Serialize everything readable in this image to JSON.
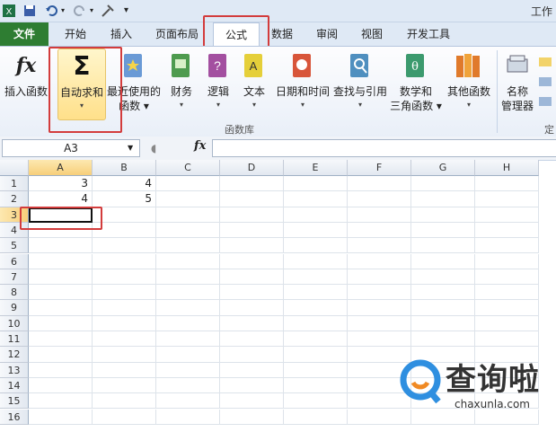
{
  "app": {
    "title": "工作"
  },
  "tabs": [
    "文件",
    "开始",
    "插入",
    "页面布局",
    "公式",
    "数据",
    "审阅",
    "视图",
    "开发工具"
  ],
  "ribbon": {
    "insert_function": "插入函数",
    "autosum_line1": "自动求和",
    "recent_line1": "最近使用的",
    "recent_line2": "函数",
    "financial": "财务",
    "logical": "逻辑",
    "text": "文本",
    "datetime": "日期和时间",
    "lookup": "查找与引用",
    "math_line1": "数学和",
    "math_line2": "三角函数",
    "other": "其他函数",
    "name_mgr_line1": "名称",
    "name_mgr_line2": "管理器",
    "edge_label": "定",
    "group_label": "函数库",
    "sigma": "Σ",
    "fx": "fx"
  },
  "formula_bar": {
    "name_box": "A3",
    "fx": "fx"
  },
  "columns": [
    "A",
    "B",
    "C",
    "D",
    "E",
    "F",
    "G",
    "H"
  ],
  "rows": [
    "1",
    "2",
    "3",
    "4",
    "5",
    "6",
    "7",
    "8",
    "9",
    "10",
    "11",
    "12",
    "13",
    "14",
    "15",
    "16"
  ],
  "cells": {
    "A1": "3",
    "B1": "4",
    "A2": "4",
    "B2": "5"
  },
  "watermark": {
    "text": "查询啦",
    "sub": "chaxunla.com"
  },
  "colors": {
    "highlight": "#d33c3c",
    "file_tab": "#2e7d32"
  }
}
